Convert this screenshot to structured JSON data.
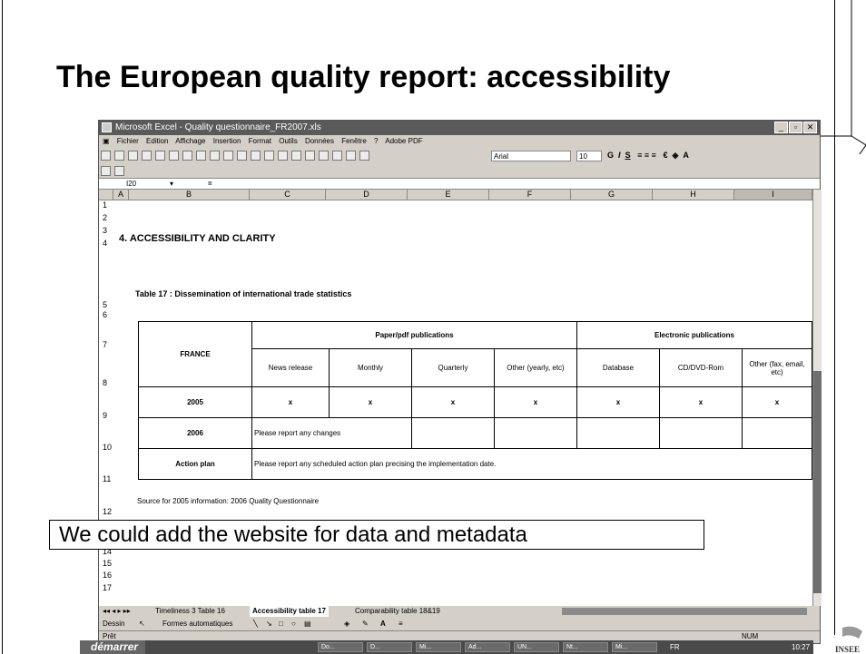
{
  "slide": {
    "title": "The European quality report: accessibility",
    "annotation": "We could add the website for data and metadata"
  },
  "excel": {
    "window_title": "Microsoft Excel - Quality questionnaire_FR2007.xls",
    "menu": [
      "Fichier",
      "Edition",
      "Affichage",
      "Insertion",
      "Format",
      "Outils",
      "Données",
      "Fenêtre",
      "?",
      "Adobe PDF"
    ],
    "font_name": "Arial",
    "font_size": "10",
    "cell_ref": "I20",
    "formula_sign": "=",
    "columns": [
      "A",
      "B",
      "C",
      "D",
      "E",
      "F",
      "G",
      "H",
      "I"
    ],
    "rows": [
      "1",
      "2",
      "3",
      "4",
      "5",
      "6",
      "7",
      "8",
      "9",
      "10",
      "11",
      "12",
      "13",
      "14",
      "15",
      "16",
      "17"
    ],
    "section_heading": "4.  ACCESSIBILITY AND CLARITY",
    "table_title": "Table 17 : Dissemination of international trade statistics",
    "table": {
      "country": "FRANCE",
      "group_paper": "Paper/pdf publications",
      "group_electronic": "Electronic publications",
      "sub_headers": [
        "News release",
        "Monthly",
        "Quarterly",
        "Other (yearly, etc)",
        "Database",
        "CD/DVD-Rom",
        "Other (fax, email, etc)"
      ],
      "row_2005_label": "2005",
      "row_2005_values": [
        "x",
        "x",
        "x",
        "x",
        "x",
        "x",
        "x"
      ],
      "row_2006_label": "2006",
      "row_2006_note": "Please report any changes",
      "row_action_label": "Action plan",
      "row_action_note": "Please report any scheduled action plan precising the implementation date."
    },
    "source_note": "Source for 2005 information: 2006 Quality Questionnaire",
    "sheet_tabs": [
      "Timeliness 3 Table 16",
      "Accessibility table 17",
      "Comparability table 18&19"
    ],
    "draw_label": "Dessin",
    "autoshapes_label": "Formes automatiques",
    "status_ready": "Prêt",
    "status_num": "NUM"
  },
  "taskbar": {
    "start_label": "démarrer",
    "tasks": [
      "Do...",
      "D...",
      "Mi...",
      "Ad...",
      "UN...",
      "Nt...",
      "Mi..."
    ],
    "lang": "FR",
    "clock": "10:27"
  },
  "logo_text": "INSEE"
}
